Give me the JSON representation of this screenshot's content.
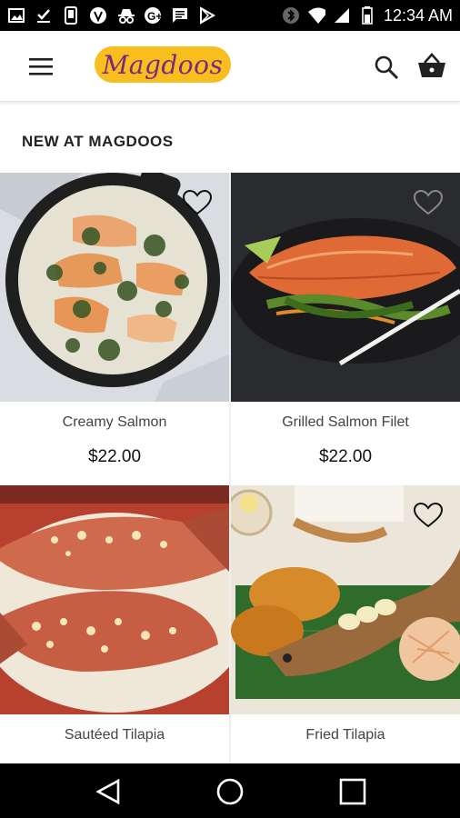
{
  "status_bar": {
    "time": "12:34 AM",
    "icons": [
      "gallery-icon",
      "download-done-icon",
      "phone-icon",
      "vine-icon",
      "incognito-icon",
      "g-plus-icon",
      "message-icon",
      "play-store-icon",
      "bluetooth-icon",
      "wifi-icon",
      "signal-icon",
      "battery-icon"
    ]
  },
  "app_bar": {
    "logo_text": "Magdoos",
    "icons": [
      "menu-icon",
      "search-icon",
      "basket-icon"
    ]
  },
  "section": {
    "title": "NEW AT MAGDOOS"
  },
  "products": [
    {
      "name": "Creamy Salmon",
      "price": "$22.00"
    },
    {
      "name": "Grilled Salmon Filet",
      "price": "$22.00"
    },
    {
      "name": "Sautéed Tilapia",
      "price": ""
    },
    {
      "name": "Fried Tilapia",
      "price": ""
    }
  ],
  "nav_bar": {
    "icons": [
      "back-icon",
      "home-icon",
      "recents-icon"
    ]
  }
}
